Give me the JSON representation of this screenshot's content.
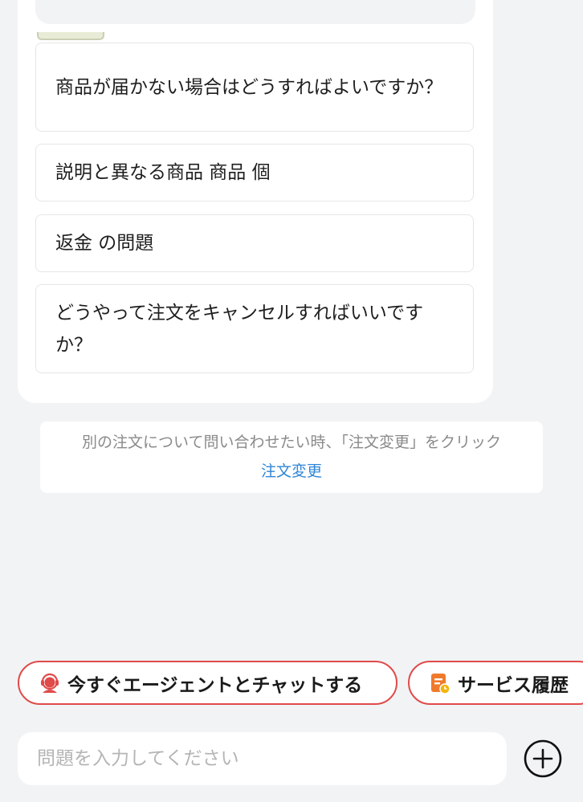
{
  "faq": {
    "items": [
      {
        "label": "商品が届かない場合はどうすればよいですか？"
      },
      {
        "label": "説明と異なる商品 商品 個"
      },
      {
        "label": "返金 の問題"
      },
      {
        "label": "どうやって注文をキャンセルすればいいですか？"
      }
    ]
  },
  "notice": {
    "text": "別の注文について問い合わせたい時、「注文変更」をクリック",
    "link": "注文変更"
  },
  "actions": {
    "agent_label": "今すぐエージェントとチャットする",
    "history_label": "サービス履歴"
  },
  "input": {
    "placeholder": "問題を入力してください",
    "value": ""
  },
  "icons": {
    "agent": "headset-agent-icon",
    "history": "service-history-icon",
    "plus": "plus-circle-icon"
  },
  "colors": {
    "accent_red": "#e04a4a",
    "link_blue": "#2f86d6",
    "history_orange": "#f07a2c"
  }
}
